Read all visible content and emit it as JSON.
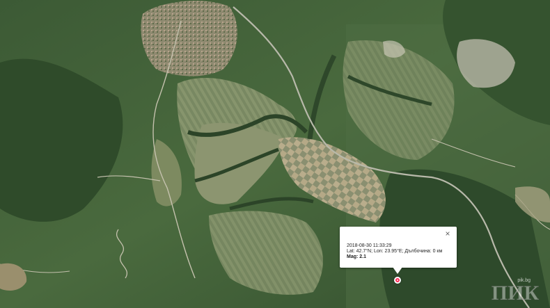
{
  "map": {
    "view": "satellite"
  },
  "popup": {
    "datetime": "2018-08-30 11:33:29",
    "coords_line": "Lat: 42.7°N; Lon: 23.95°E; Дълбочина: 0 км",
    "mag_line": "Mag: 2.1",
    "close_symbol": "×"
  },
  "marker": {
    "icon": "epicenter-marker-icon",
    "color": "#ff2a55"
  },
  "watermark": {
    "logo_text": "ПИК",
    "site_text": "pik.bg"
  }
}
